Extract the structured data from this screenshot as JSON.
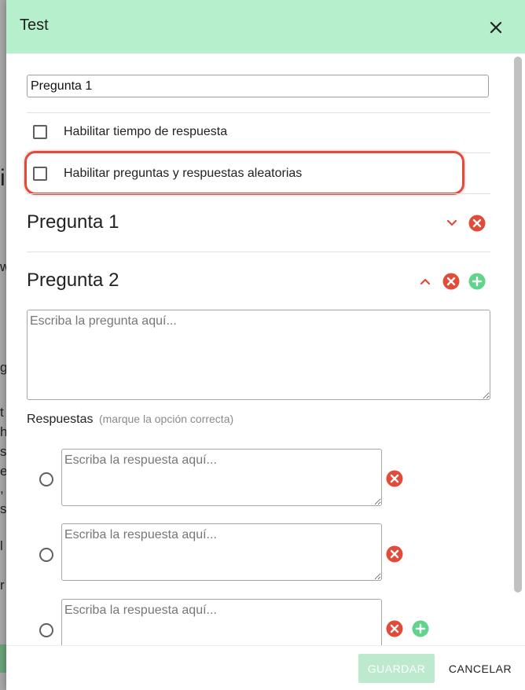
{
  "dialog": {
    "title": "Test",
    "close_icon": "close-icon"
  },
  "form": {
    "test_title_value": "Pregunta 1",
    "enable_time_label": "Habilitar tiempo de respuesta",
    "enable_time_checked": false,
    "enable_random_label": "Habilitar preguntas y respuestas aleatorias",
    "enable_random_checked": false
  },
  "questions": [
    {
      "heading": "Pregunta 1",
      "collapsed": true,
      "icons": [
        "chevron-down-icon",
        "remove-icon"
      ]
    },
    {
      "heading": "Pregunta 2",
      "collapsed": false,
      "icons": [
        "chevron-up-icon",
        "remove-icon",
        "add-icon"
      ],
      "question_placeholder": "Escriba la pregunta aquí...",
      "answers_label": "Respuestas",
      "answers_hint": "(marque la opción correcta)",
      "answers": [
        {
          "placeholder": "Escriba la respuesta aquí...",
          "selected": false
        },
        {
          "placeholder": "Escriba la respuesta aquí...",
          "selected": false
        },
        {
          "placeholder": "Escriba la respuesta aquí...",
          "selected": false
        }
      ]
    }
  ],
  "footer": {
    "save_label": "GUARDAR",
    "cancel_label": "CANCELAR"
  },
  "colors": {
    "header_bg": "#b5efcc",
    "remove_red": "#e04b3a",
    "add_green": "#5fd48a",
    "save_disabled": "#bde9cf",
    "highlight": "#e04b3a"
  }
}
